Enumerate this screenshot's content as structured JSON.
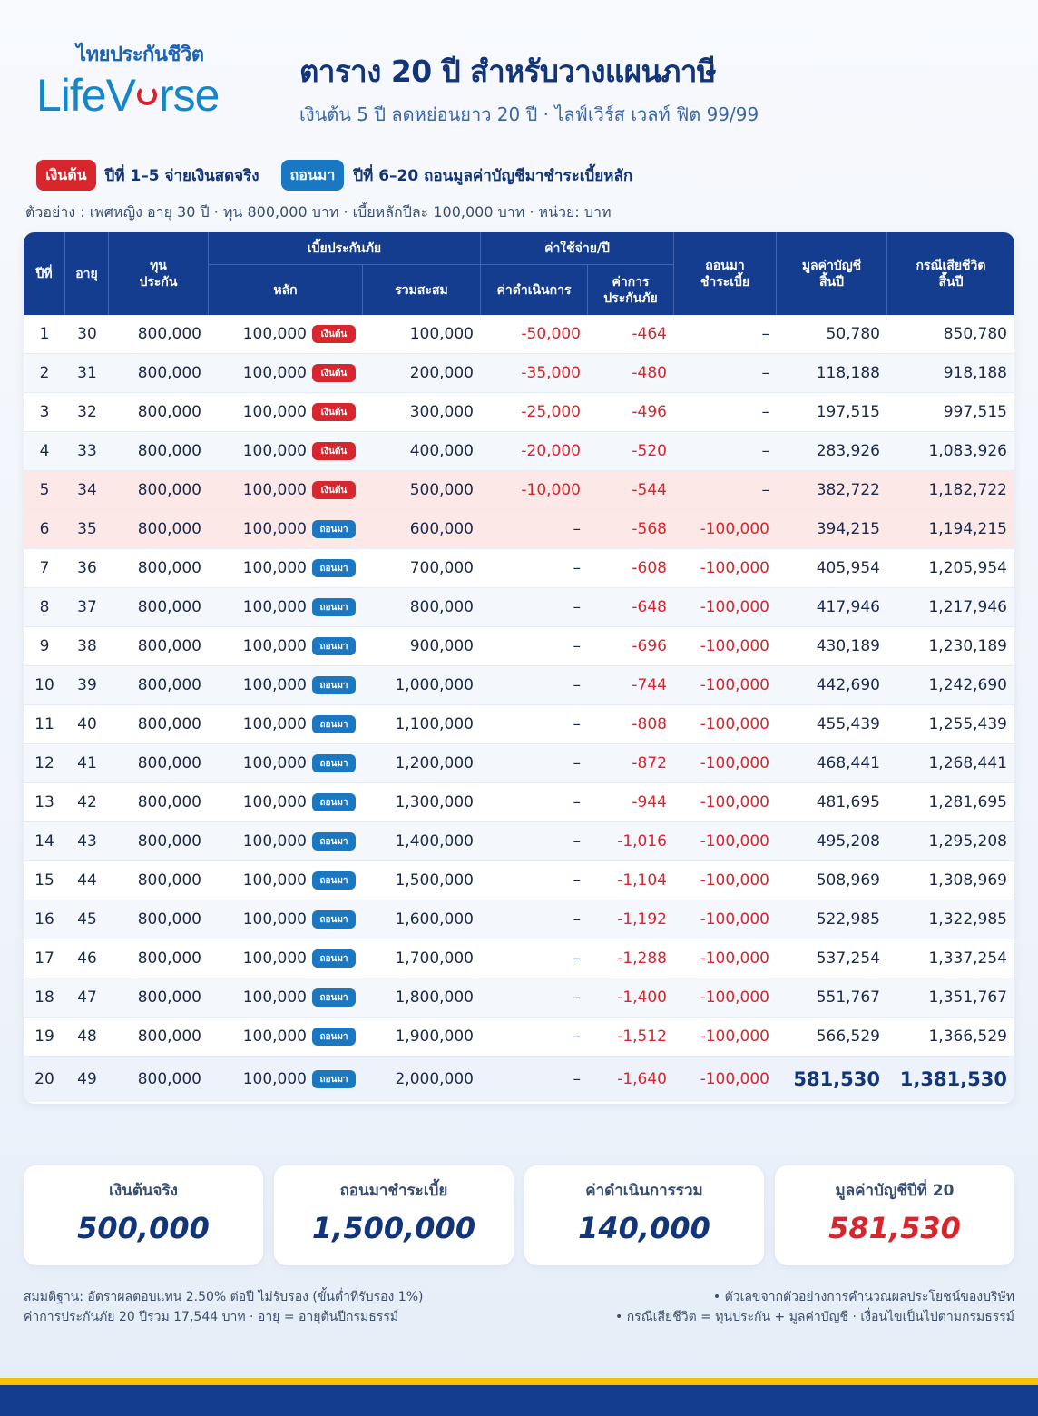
{
  "logo": {
    "thai": "ไทยประกันชีวิต",
    "en_left": "LifeV",
    "en_right": "rse"
  },
  "header": {
    "title": "ตาราง 20 ปี สำหรับวางแผนภาษี",
    "subtitle": "เงินต้น 5 ปี ลดหย่อนยาว 20 ปี · ไลฟ์เวิร์ส เวลท์ ฟิต 99/99"
  },
  "legend": {
    "pay_tag": "เงินต้น",
    "pay_text": "ปีที่ 1–5 จ่ายเงินสดจริง",
    "withdraw_tag": "ถอนมา",
    "withdraw_text": "ปีที่ 6–20 ถอนมูลค่าบัญชีมาชำระเบี้ยหลัก"
  },
  "example": "ตัวอย่าง : เพศหญิง อายุ 30 ปี · ทุน 800,000 บาท · เบี้ยหลักปีละ 100,000 บาท · หน่วย: บาท",
  "table": {
    "headers": {
      "year": "ปีที่",
      "age": "อายุ",
      "sum_insured": "ทุน\nประกัน",
      "premium_group": "เบี้ยประกันภัย",
      "premium_main": "หลัก",
      "premium_cum": "รวมสะสม",
      "expense_group": "ค่าใช้จ่าย/ปี",
      "admin_fee": "ค่าดำเนินการ",
      "coi": "ค่าการ\nประกันภัย",
      "withdraw": "ถอนมา\nชำระเบี้ย",
      "account_value": "มูลค่าบัญชี\nสิ้นปี",
      "death_benefit": "กรณีเสียชีวิต\nสิ้นปี"
    },
    "rows": [
      {
        "year": "1",
        "age": "30",
        "sum": "800,000",
        "premium": "100,000",
        "tag": "เงินต้น",
        "tag_type": "red",
        "cum": "100,000",
        "admin": "-50,000",
        "coi": "-464",
        "withdraw": "–",
        "av": "50,780",
        "death": "850,780"
      },
      {
        "year": "2",
        "age": "31",
        "sum": "800,000",
        "premium": "100,000",
        "tag": "เงินต้น",
        "tag_type": "red",
        "cum": "200,000",
        "admin": "-35,000",
        "coi": "-480",
        "withdraw": "–",
        "av": "118,188",
        "death": "918,188"
      },
      {
        "year": "3",
        "age": "32",
        "sum": "800,000",
        "premium": "100,000",
        "tag": "เงินต้น",
        "tag_type": "red",
        "cum": "300,000",
        "admin": "-25,000",
        "coi": "-496",
        "withdraw": "–",
        "av": "197,515",
        "death": "997,515"
      },
      {
        "year": "4",
        "age": "33",
        "sum": "800,000",
        "premium": "100,000",
        "tag": "เงินต้น",
        "tag_type": "red",
        "cum": "400,000",
        "admin": "-20,000",
        "coi": "-520",
        "withdraw": "–",
        "av": "283,926",
        "death": "1,083,926"
      },
      {
        "year": "5",
        "age": "34",
        "sum": "800,000",
        "premium": "100,000",
        "tag": "เงินต้น",
        "tag_type": "red",
        "cum": "500,000",
        "admin": "-10,000",
        "coi": "-544",
        "withdraw": "–",
        "av": "382,722",
        "death": "1,182,722"
      },
      {
        "year": "6",
        "age": "35",
        "sum": "800,000",
        "premium": "100,000",
        "tag": "ถอนมา",
        "tag_type": "blue",
        "cum": "600,000",
        "admin": "–",
        "coi": "-568",
        "withdraw": "-100,000",
        "av": "394,215",
        "death": "1,194,215"
      },
      {
        "year": "7",
        "age": "36",
        "sum": "800,000",
        "premium": "100,000",
        "tag": "ถอนมา",
        "tag_type": "blue",
        "cum": "700,000",
        "admin": "–",
        "coi": "-608",
        "withdraw": "-100,000",
        "av": "405,954",
        "death": "1,205,954"
      },
      {
        "year": "8",
        "age": "37",
        "sum": "800,000",
        "premium": "100,000",
        "tag": "ถอนมา",
        "tag_type": "blue",
        "cum": "800,000",
        "admin": "–",
        "coi": "-648",
        "withdraw": "-100,000",
        "av": "417,946",
        "death": "1,217,946"
      },
      {
        "year": "9",
        "age": "38",
        "sum": "800,000",
        "premium": "100,000",
        "tag": "ถอนมา",
        "tag_type": "blue",
        "cum": "900,000",
        "admin": "–",
        "coi": "-696",
        "withdraw": "-100,000",
        "av": "430,189",
        "death": "1,230,189"
      },
      {
        "year": "10",
        "age": "39",
        "sum": "800,000",
        "premium": "100,000",
        "tag": "ถอนมา",
        "tag_type": "blue",
        "cum": "1,000,000",
        "admin": "–",
        "coi": "-744",
        "withdraw": "-100,000",
        "av": "442,690",
        "death": "1,242,690"
      },
      {
        "year": "11",
        "age": "40",
        "sum": "800,000",
        "premium": "100,000",
        "tag": "ถอนมา",
        "tag_type": "blue",
        "cum": "1,100,000",
        "admin": "–",
        "coi": "-808",
        "withdraw": "-100,000",
        "av": "455,439",
        "death": "1,255,439"
      },
      {
        "year": "12",
        "age": "41",
        "sum": "800,000",
        "premium": "100,000",
        "tag": "ถอนมา",
        "tag_type": "blue",
        "cum": "1,200,000",
        "admin": "–",
        "coi": "-872",
        "withdraw": "-100,000",
        "av": "468,441",
        "death": "1,268,441"
      },
      {
        "year": "13",
        "age": "42",
        "sum": "800,000",
        "premium": "100,000",
        "tag": "ถอนมา",
        "tag_type": "blue",
        "cum": "1,300,000",
        "admin": "–",
        "coi": "-944",
        "withdraw": "-100,000",
        "av": "481,695",
        "death": "1,281,695"
      },
      {
        "year": "14",
        "age": "43",
        "sum": "800,000",
        "premium": "100,000",
        "tag": "ถอนมา",
        "tag_type": "blue",
        "cum": "1,400,000",
        "admin": "–",
        "coi": "-1,016",
        "withdraw": "-100,000",
        "av": "495,208",
        "death": "1,295,208"
      },
      {
        "year": "15",
        "age": "44",
        "sum": "800,000",
        "premium": "100,000",
        "tag": "ถอนมา",
        "tag_type": "blue",
        "cum": "1,500,000",
        "admin": "–",
        "coi": "-1,104",
        "withdraw": "-100,000",
        "av": "508,969",
        "death": "1,308,969"
      },
      {
        "year": "16",
        "age": "45",
        "sum": "800,000",
        "premium": "100,000",
        "tag": "ถอนมา",
        "tag_type": "blue",
        "cum": "1,600,000",
        "admin": "–",
        "coi": "-1,192",
        "withdraw": "-100,000",
        "av": "522,985",
        "death": "1,322,985"
      },
      {
        "year": "17",
        "age": "46",
        "sum": "800,000",
        "premium": "100,000",
        "tag": "ถอนมา",
        "tag_type": "blue",
        "cum": "1,700,000",
        "admin": "–",
        "coi": "-1,288",
        "withdraw": "-100,000",
        "av": "537,254",
        "death": "1,337,254"
      },
      {
        "year": "18",
        "age": "47",
        "sum": "800,000",
        "premium": "100,000",
        "tag": "ถอนมา",
        "tag_type": "blue",
        "cum": "1,800,000",
        "admin": "–",
        "coi": "-1,400",
        "withdraw": "-100,000",
        "av": "551,767",
        "death": "1,351,767"
      },
      {
        "year": "19",
        "age": "48",
        "sum": "800,000",
        "premium": "100,000",
        "tag": "ถอนมา",
        "tag_type": "blue",
        "cum": "1,900,000",
        "admin": "–",
        "coi": "-1,512",
        "withdraw": "-100,000",
        "av": "566,529",
        "death": "1,366,529"
      },
      {
        "year": "20",
        "age": "49",
        "sum": "800,000",
        "premium": "100,000",
        "tag": "ถอนมา",
        "tag_type": "blue",
        "cum": "2,000,000",
        "admin": "–",
        "coi": "-1,640",
        "withdraw": "-100,000",
        "av": "581,530",
        "death": "1,381,530"
      }
    ]
  },
  "summary": [
    {
      "label": "เงินต้นจริง",
      "value": "500,000",
      "color": "#12357a"
    },
    {
      "label": "ถอนมาชำระเบี้ย",
      "value": "1,500,000",
      "color": "#12357a"
    },
    {
      "label": "ค่าดำเนินการรวม",
      "value": "140,000",
      "color": "#12357a"
    },
    {
      "label": "มูลค่าบัญชีปีที่ 20",
      "value": "581,530",
      "color": "#d7262e"
    }
  ],
  "footer": {
    "left_1": "สมมติฐาน: อัตราผลตอบแทน 2.50% ต่อปี ไม่รับรอง (ขั้นต่ำที่รับรอง 1%)",
    "left_2": "ค่าการประกันภัย 20 ปีรวม 17,544 บาท · อายุ = อายุต้นปีกรมธรรม์",
    "right_1": "• ตัวเลขจากตัวอย่างการคำนวณผลประโยชน์ของบริษัท",
    "right_2": "• กรณีเสียชีวิต = ทุนประกัน + มูลค่าบัญชี · เงื่อนไขเป็นไปตามกรมธรรม์"
  },
  "colors": {
    "navy": "#143c8f",
    "red": "#d7262e",
    "blue": "#1a78c2",
    "yellow": "#f6c200"
  }
}
